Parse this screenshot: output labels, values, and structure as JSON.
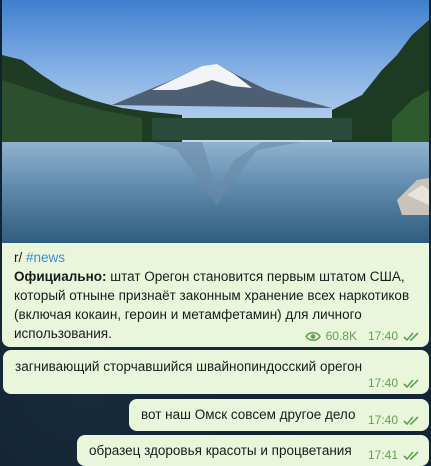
{
  "post": {
    "prefix": "r/",
    "hashtag": "#news",
    "bold_text": "Официально:",
    "text_line1": " штат Орегон становится первым штатом США,",
    "text_line2": "который отныне признаёт законным хранение всех наркотиков",
    "text_line3": "(включая кокаин, героин и метамфетамин) для личного",
    "text_line4": "использования.",
    "views": "60.8K",
    "time": "17:40",
    "image_description_icon": "mountain-lake-photo"
  },
  "messages": [
    {
      "text": "загнивающий сторчавшийся швайнопиндосский орегон",
      "time": "17:40"
    },
    {
      "text": "вот наш Омск совсем другое дело",
      "time": "17:40"
    },
    {
      "text": "образец здоровья красоты и процветания",
      "time": "17:41"
    }
  ],
  "colors": {
    "bubble": "#eaf6dc",
    "accent": "#5ea04f",
    "hashtag": "#3a8fd0",
    "chat_bg": "#112231"
  }
}
